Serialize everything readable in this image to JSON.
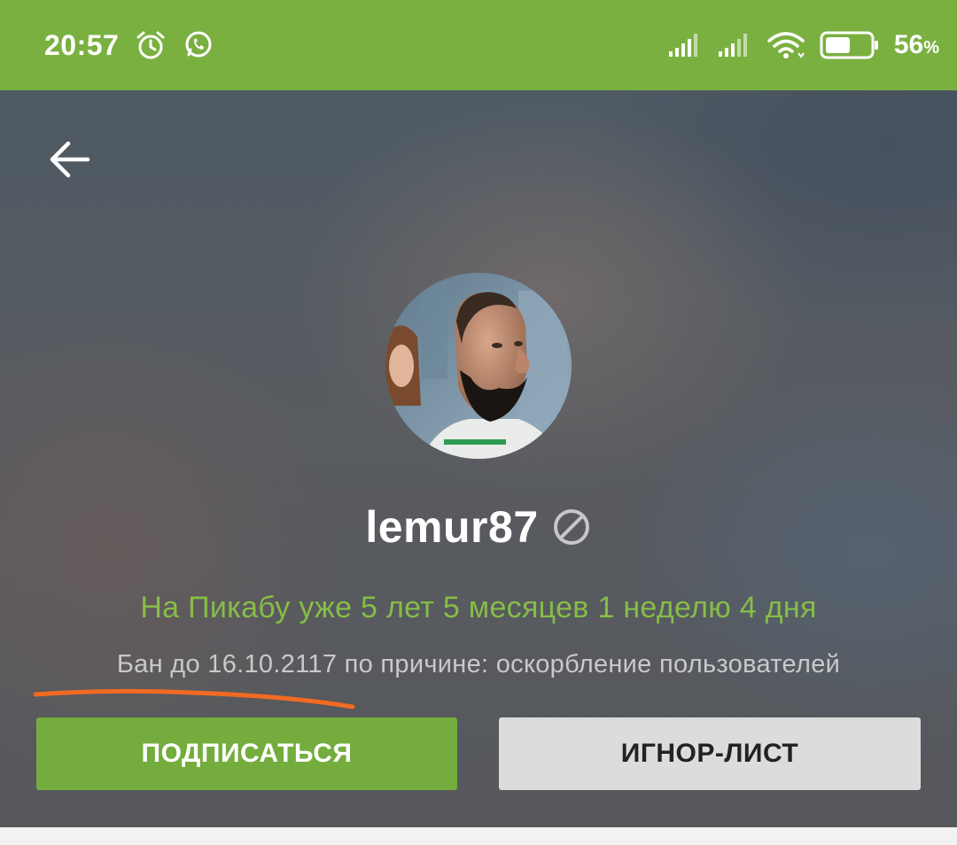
{
  "status_bar": {
    "time": "20:57",
    "icons": [
      "alarm-icon",
      "whatsapp-icon",
      "signal-icon",
      "signal-icon",
      "wifi-icon",
      "battery-icon"
    ],
    "battery_level": 0.56,
    "battery_number": "56",
    "battery_unit": "%"
  },
  "colors": {
    "status_bar": "#7ab040",
    "accent_green": "#74ad3d",
    "tenure_text": "#86bd47",
    "underline": "#f26a21"
  },
  "profile": {
    "username": "lemur87",
    "banned_icon": "banned-icon",
    "tenure": "На Пикабу уже 5 лет 5 месяцев 1 неделю 4 дня",
    "ban_info": "Бан до 16.10.2117 по причине: оскорбление пользователей"
  },
  "actions": {
    "subscribe_label": "ПОДПИСАТЬСЯ",
    "ignore_label": "ИГНОР-ЛИСТ"
  },
  "navigation": {
    "back_icon": "arrow-left-icon"
  }
}
